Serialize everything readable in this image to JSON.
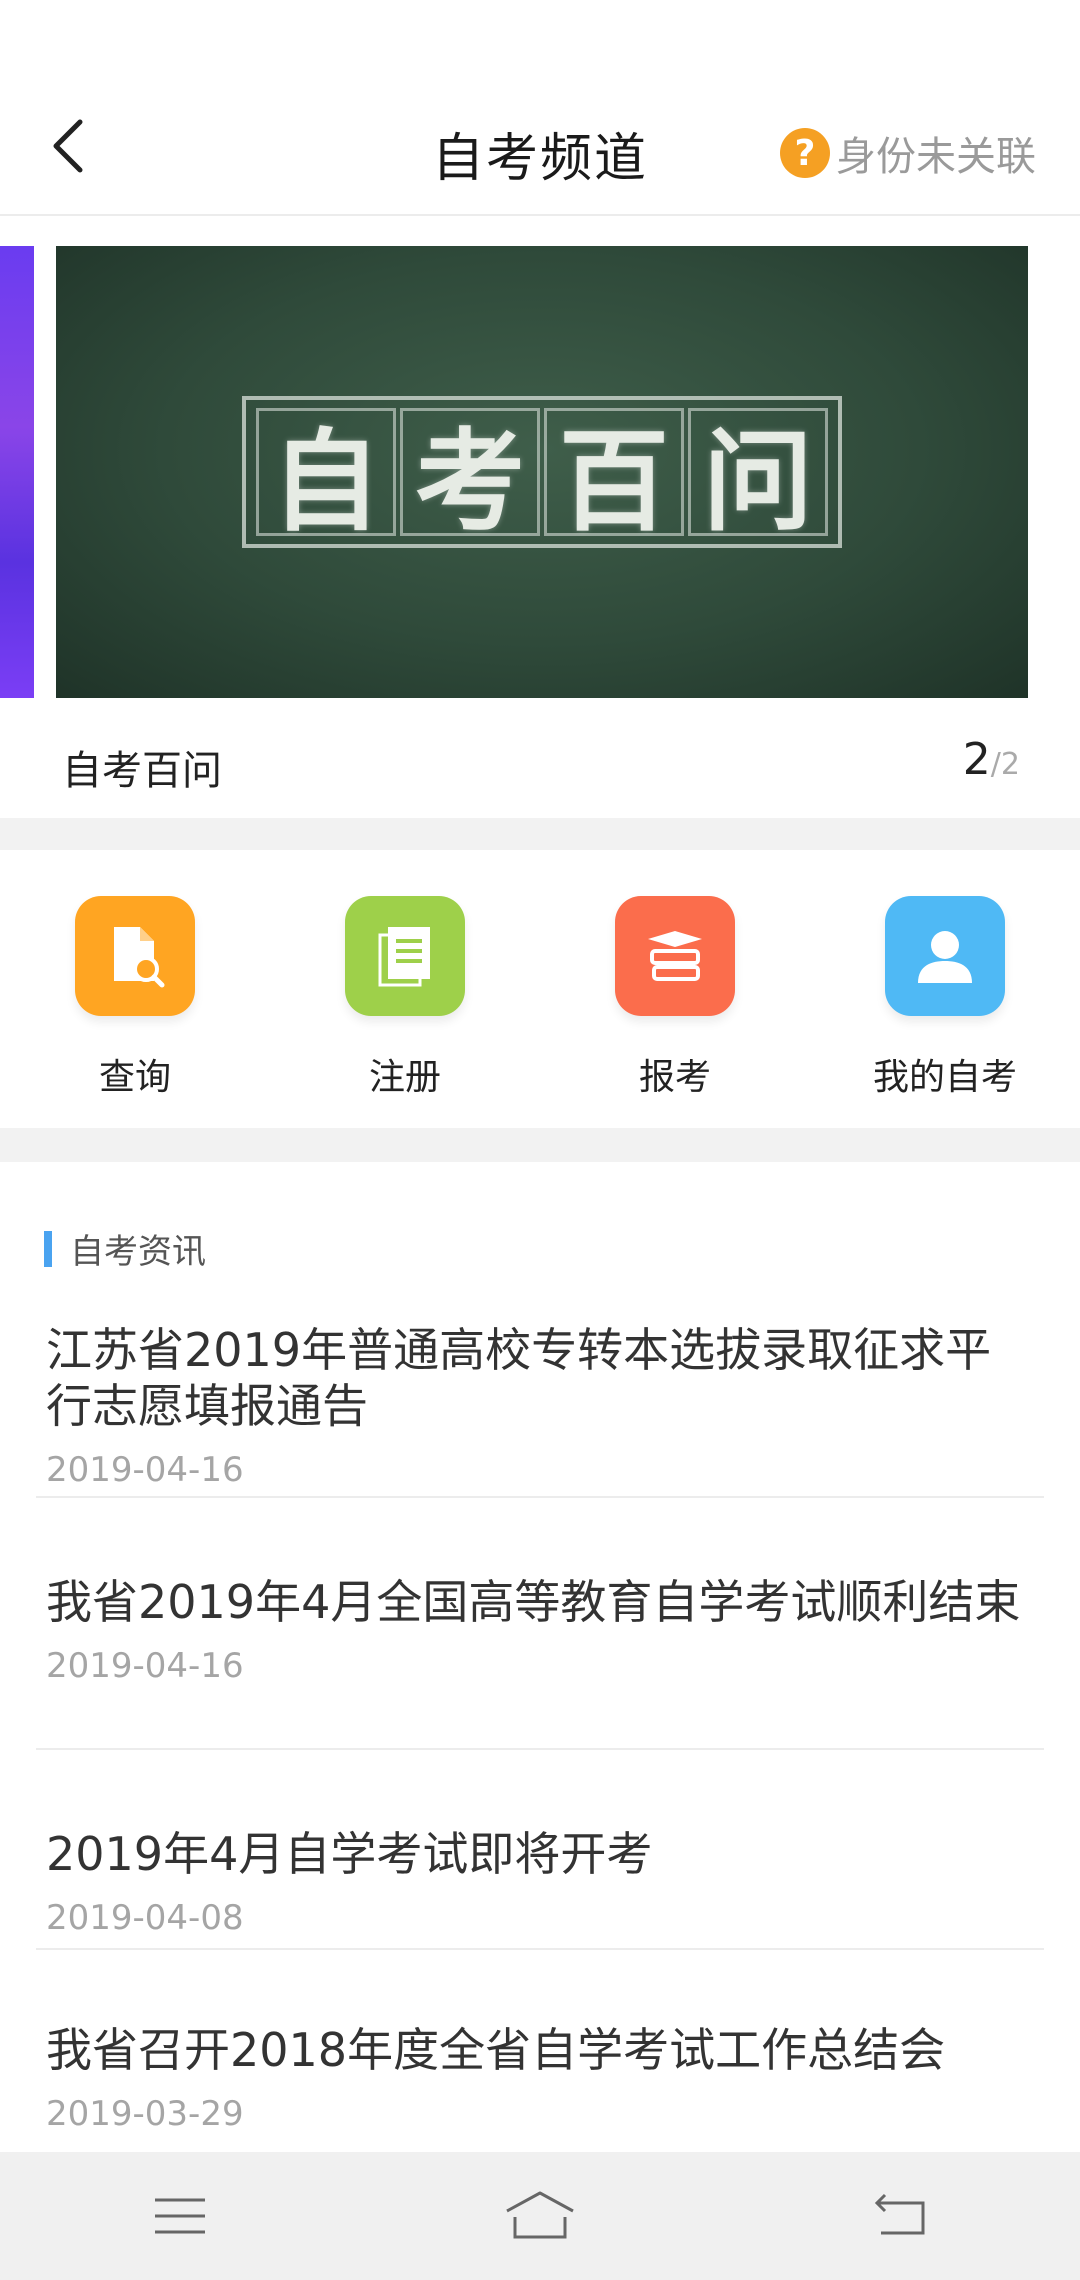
{
  "header": {
    "title": "自考频道",
    "identity_label": "身份未关联"
  },
  "banner": {
    "chalk_chars": [
      "自",
      "考",
      "百",
      "问"
    ],
    "caption": "自考百问",
    "current": "2",
    "total": "/2"
  },
  "quick_nav": [
    {
      "label": "查询",
      "color": "#ffa522",
      "icon": "search-document-icon"
    },
    {
      "label": "注册",
      "color": "#9ed04a",
      "icon": "register-document-icon"
    },
    {
      "label": "报考",
      "color": "#fb6d4c",
      "icon": "graduation-cap-icon"
    },
    {
      "label": "我的自考",
      "color": "#4fb9f5",
      "icon": "user-avatar-icon"
    }
  ],
  "news_section": {
    "title": "自考资讯",
    "items": [
      {
        "title": "江苏省2019年普通高校专转本选拔录取征求平行志愿填报通告",
        "date": "2019-04-16"
      },
      {
        "title": "我省2019年4月全国高等教育自学考试顺利结束",
        "date": "2019-04-16"
      },
      {
        "title": "2019年4月自学考试即将开考",
        "date": "2019-04-08"
      },
      {
        "title": "我省召开2018年度全省自学考试工作总结会",
        "date": "2019-03-29"
      }
    ]
  },
  "colors": {
    "accent_blue": "#4aa3f0",
    "question_orange": "#f5a023"
  }
}
